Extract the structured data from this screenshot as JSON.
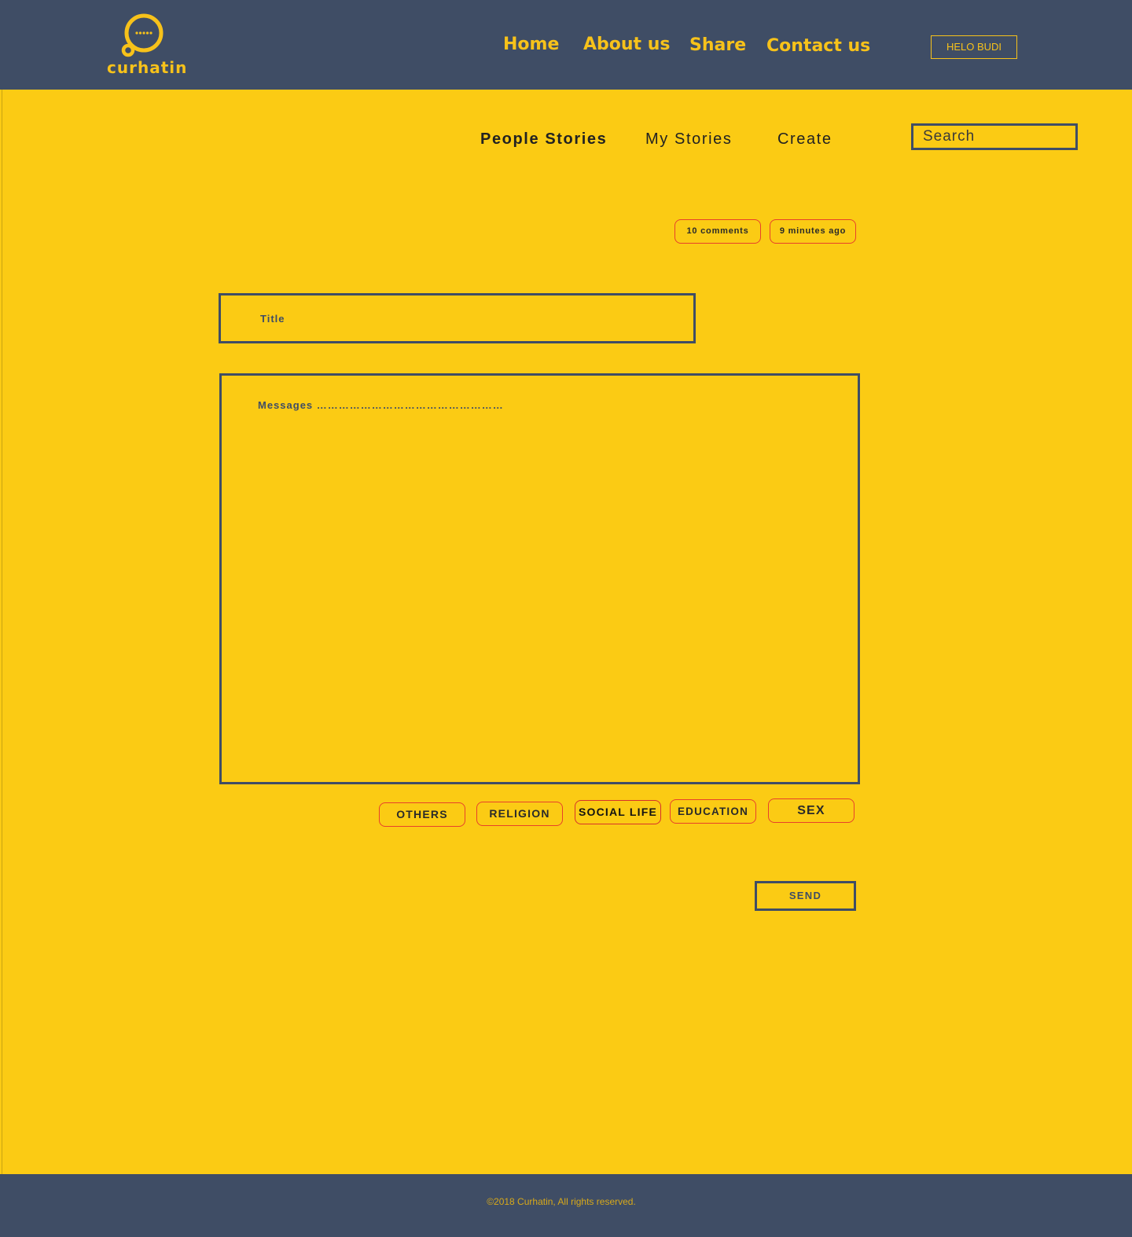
{
  "brand": {
    "name": "curhatin",
    "logo_icon": "chat-bubble-icon",
    "accent_color": "#f7c21a",
    "header_color": "#3f4d65",
    "page_color": "#fbcb14"
  },
  "nav": {
    "home": "Home",
    "about": "About us",
    "share": "Share",
    "contact": "Contact us"
  },
  "user": {
    "greeting_button": "HELO BUDI"
  },
  "subnav": {
    "people_stories": "People Stories",
    "my_stories": "My Stories",
    "create": "Create"
  },
  "search": {
    "placeholder": "Search",
    "value": ""
  },
  "meta": {
    "comments": "10 comments",
    "time": "9 minutes ago"
  },
  "form": {
    "title_placeholder": "Title",
    "title_value": "",
    "message_placeholder": "Messages ……………………………………………",
    "message_value": ""
  },
  "categories": [
    "OTHERS",
    "RELIGION",
    "SOCIAL LIFE",
    "EDUCATION",
    "SEX"
  ],
  "send_label": "SEND",
  "footer": {
    "copyright": "©2018 Curhatin, All rights reserved."
  }
}
